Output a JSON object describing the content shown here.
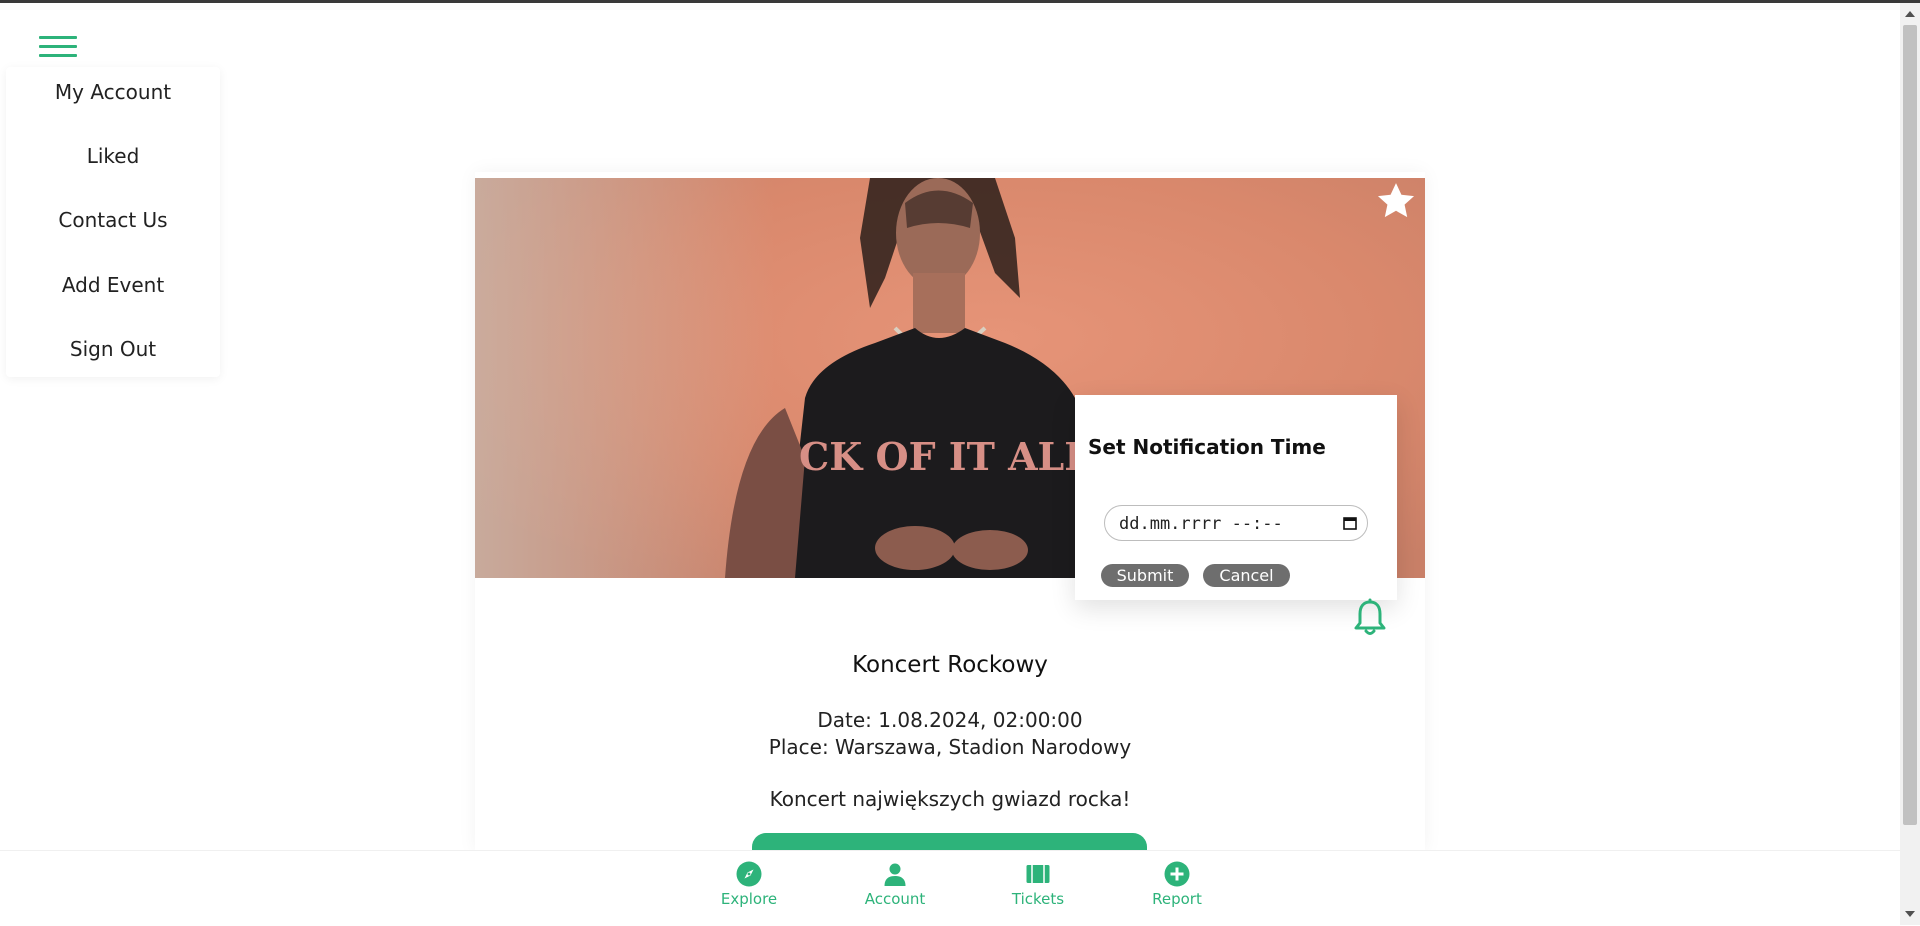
{
  "menu": {
    "items": [
      {
        "label": "My Account"
      },
      {
        "label": "Liked"
      },
      {
        "label": "Contact Us"
      },
      {
        "label": "Add Event"
      },
      {
        "label": "Sign Out"
      }
    ]
  },
  "event": {
    "title": "Koncert Rockowy",
    "date": "Date: 1.08.2024, 02:00:00",
    "place": "Place: Warszawa, Stadion Narodowy",
    "description": "Koncert największych gwiazd rocka!",
    "shirt_text": "CK OF IT ALL"
  },
  "notification": {
    "title": "Set Notification Time",
    "input_value": "dd.mm.rrrr --:--",
    "submit_label": "Submit",
    "cancel_label": "Cancel"
  },
  "bottom_nav": {
    "items": [
      {
        "label": "Explore",
        "icon": "compass-icon"
      },
      {
        "label": "Account",
        "icon": "person-icon"
      },
      {
        "label": "Tickets",
        "icon": "ticket-icon"
      },
      {
        "label": "Report",
        "icon": "plus-circle-icon"
      }
    ]
  },
  "colors": {
    "accent": "#2db37a",
    "pill": "#6e6e6e"
  }
}
